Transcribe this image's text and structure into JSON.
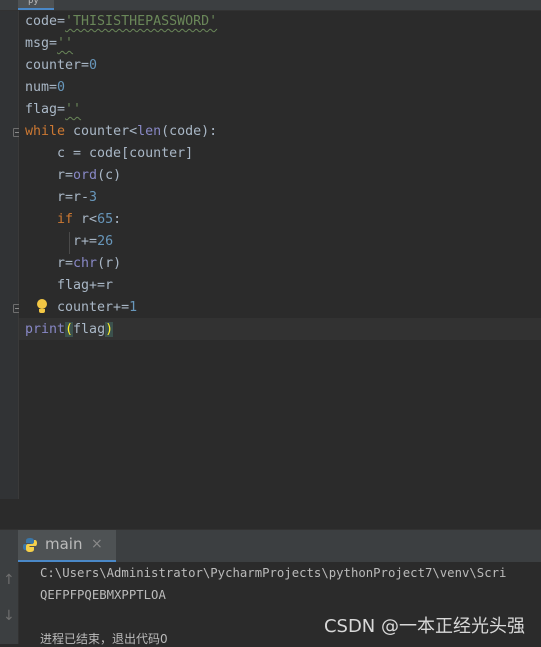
{
  "editor": {
    "active_tab": "py",
    "lines": [
      [
        {
          "t": "code="
        },
        {
          "t": "'THISISTHEPASSWORD'",
          "c": "str squig"
        }
      ],
      [
        {
          "t": "msg="
        },
        {
          "t": "''",
          "c": "str squig"
        }
      ],
      [
        {
          "t": "counter="
        },
        {
          "t": "0",
          "c": "num"
        }
      ],
      [
        {
          "t": "num="
        },
        {
          "t": "0",
          "c": "num"
        }
      ],
      [
        {
          "t": "flag="
        },
        {
          "t": "''",
          "c": "str squig"
        }
      ],
      [
        {
          "t": "while",
          "c": "kw"
        },
        {
          "t": " counter<"
        },
        {
          "t": "len",
          "c": "fn"
        },
        {
          "t": "(code):"
        }
      ],
      [
        {
          "t": "    c = code[counter]"
        }
      ],
      [
        {
          "t": "    r="
        },
        {
          "t": "ord",
          "c": "fn"
        },
        {
          "t": "(c)"
        }
      ],
      [
        {
          "t": "    r=r-"
        },
        {
          "t": "3",
          "c": "num"
        }
      ],
      [
        {
          "t": "    "
        },
        {
          "t": "if",
          "c": "kw"
        },
        {
          "t": " r<"
        },
        {
          "t": "65",
          "c": "num"
        },
        {
          "t": ":"
        }
      ],
      [
        {
          "t": "      r+="
        },
        {
          "t": "26",
          "c": "num"
        }
      ],
      [
        {
          "t": "    r="
        },
        {
          "t": "chr",
          "c": "fn"
        },
        {
          "t": "(r)"
        }
      ],
      [
        {
          "t": "    flag+=r"
        }
      ],
      [
        {
          "t": "    counter+="
        },
        {
          "t": "1",
          "c": "num"
        }
      ],
      [
        {
          "t": "print",
          "c": "fn"
        },
        {
          "t": "(",
          "c": "paren-hl"
        },
        {
          "t": "flag"
        },
        {
          "t": ")",
          "c": "paren-hl"
        }
      ]
    ]
  },
  "run_panel": {
    "tab_label": "main",
    "close_glyph": "×"
  },
  "console": {
    "command": "C:\\Users\\Administrator\\PycharmProjects\\pythonProject7\\venv\\Scri",
    "output": "QEFPFPQEBMXPPTLOA",
    "exit": "进程已结束，退出代码0"
  },
  "watermark": "CSDN @一本正经光头强",
  "colors": {
    "background": "#2b2b2b",
    "keyword": "#cc7832",
    "string": "#6a8759",
    "number": "#6897bb",
    "builtin": "#8888c6",
    "accent": "#4a88c7"
  }
}
